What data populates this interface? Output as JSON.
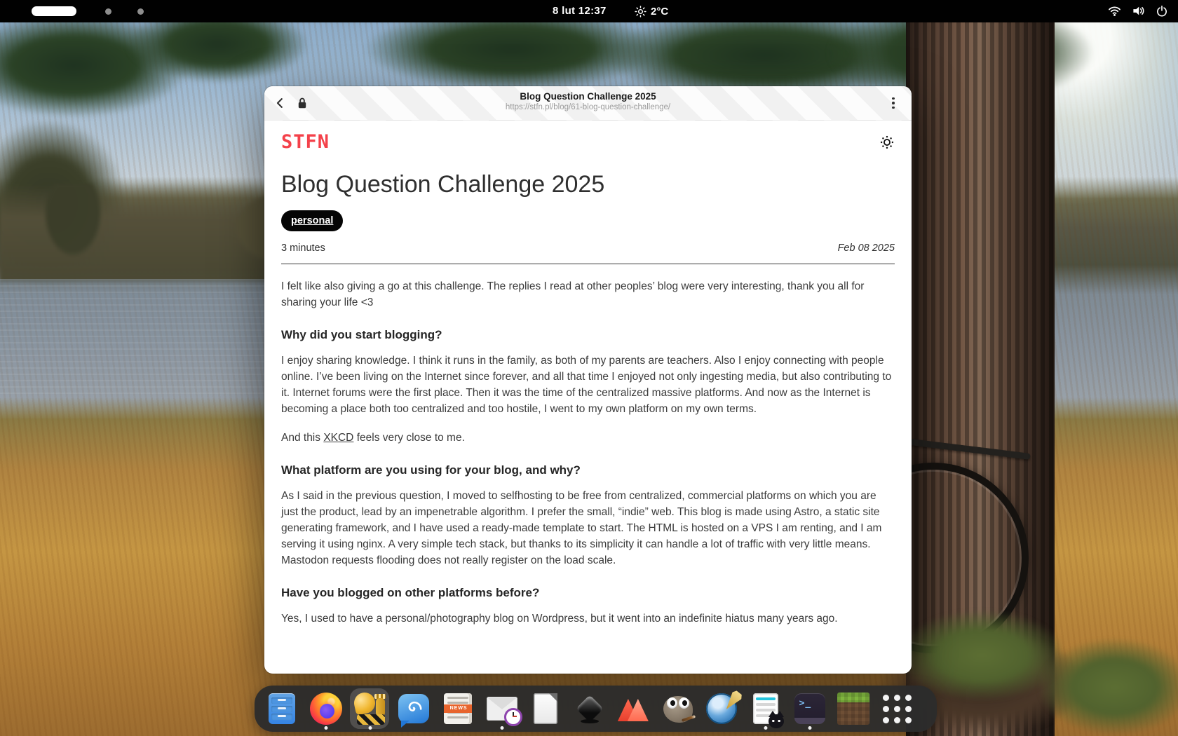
{
  "topbar": {
    "clock": "8 lut  12:37",
    "weather_temp": "2°C",
    "icons": [
      "workspace-pill",
      "sun-icon",
      "wifi-icon",
      "volume-icon",
      "power-icon"
    ]
  },
  "browser": {
    "title": "Blog Question Challenge 2025",
    "url": "https://stfn.pl/blog/61-blog-question-challenge/",
    "icons": [
      "back-icon",
      "lock-icon",
      "kebab-menu-icon"
    ]
  },
  "page": {
    "logo": "STFN",
    "theme_toggle_icon": "sun-icon",
    "title": "Blog Question Challenge 2025",
    "tag": "personal",
    "read_time": "3 minutes",
    "date": "Feb 08 2025",
    "intro": "I felt like also giving a go at this challenge. The replies I read at other peoples’ blog were very interesting, thank you all for sharing your life <3",
    "sections": [
      {
        "heading": "Why did you start blogging?",
        "paragraphs": [
          "I enjoy sharing knowledge. I think it runs in the family, as both of my parents are teachers. Also I enjoy connecting with people online. I’ve been living on the Internet since forever, and all that time I enjoyed not only ingesting media, but also contributing to it. Internet forums were the first place. Then it was the time of the centralized massive platforms. And now as the Internet is becoming a place both too centralized and too hostile, I went to my own platform on my own terms."
        ],
        "link_sentence": {
          "pre": "And this ",
          "link": "XKCD",
          "post": " feels very close to me."
        }
      },
      {
        "heading": "What platform are you using for your blog, and why?",
        "paragraphs": [
          "As I said in the previous question, I moved to selfhosting to be free from centralized, commercial platforms on which you are just the product, lead by an impenetrable algorithm. I prefer the small, “indie” web. This blog is made using Astro, a static site generating framework, and I have used a ready-made template to start. The HTML is hosted on a VPS I am renting, and I am serving it using nginx. A very simple tech stack, but thanks to its simplicity it can handle a lot of traffic with very little means. Mastodon requests flooding does not really register on the load scale."
        ]
      },
      {
        "heading": "Have you blogged on other platforms before?",
        "paragraphs": [
          "Yes, I used to have a personal/photography blog on Wordpress, but it went into an indefinite hiatus many years ago."
        ]
      }
    ]
  },
  "dock": {
    "items": [
      {
        "name": "files"
      },
      {
        "name": "firefox",
        "running": true
      },
      {
        "name": "tuba",
        "running": true,
        "active": true
      },
      {
        "name": "fractal"
      },
      {
        "name": "newsflash",
        "band_label": "NEWS"
      },
      {
        "name": "evolution",
        "running": true
      },
      {
        "name": "libreoffice"
      },
      {
        "name": "inkscape"
      },
      {
        "name": "red-triangles-app"
      },
      {
        "name": "gimp"
      },
      {
        "name": "scribus"
      },
      {
        "name": "notes-cat-app",
        "running": true
      },
      {
        "name": "terminal",
        "running": true,
        "prompt": ">_"
      },
      {
        "name": "minecraft"
      },
      {
        "name": "show-apps"
      }
    ]
  },
  "colors": {
    "accent_red": "#f4414a",
    "tag_bg": "#050505",
    "topbar_bg": "#010101",
    "dock_bg": "#2c2c2c",
    "page_bg": "#ffffff"
  }
}
